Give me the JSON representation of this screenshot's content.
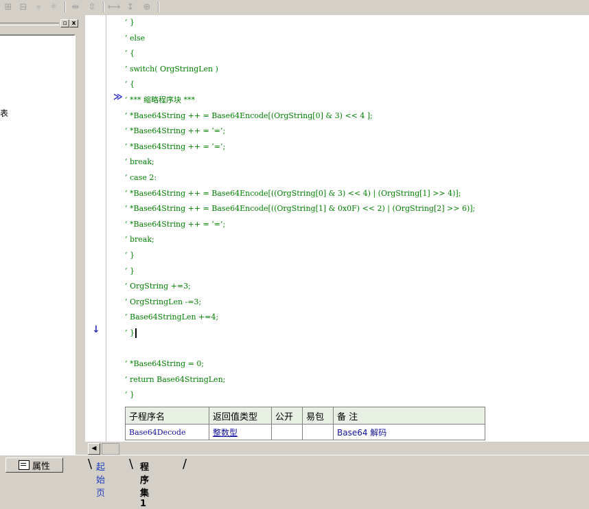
{
  "toolbar": {
    "icons": [
      "align-left-icon",
      "align-center-icon",
      "align-top-icon",
      "align-middle-icon",
      "space-horizontal-icon",
      "space-vertical-icon",
      "same-width-icon",
      "same-height-icon",
      "same-size-icon"
    ]
  },
  "left_pane": {
    "minimize_glyph": "▫",
    "close_glyph": "x",
    "stray_char": "表"
  },
  "editor": {
    "lines": [
      "’ }",
      "’ else",
      "’ {",
      "’ switch( OrgStringLen )",
      "’ {",
      "’ *** 缩略程序块 ***",
      "’ *Base64String ++ = Base64Encode[(OrgString[0] & 3) << 4 ];",
      "’ *Base64String ++ = ’=’;",
      "’ *Base64String ++ = ’=’;",
      "’ break;",
      "’ case 2:",
      "’ *Base64String ++ = Base64Encode[((OrgString[0] & 3) << 4) | (OrgString[1] >> 4)];",
      "’ *Base64String ++ = Base64Encode[((OrgString[1] & 0x0F) << 2) | (OrgString[2] >> 6)];",
      "’ *Base64String ++ = ’=’;",
      "’ break;",
      "’ }",
      "’ }",
      "’ OrgString +=3;",
      "’ OrgStringLen -=3;",
      "’ Base64StringLen +=4;",
      "’ }",
      "",
      "’ *Base64String = 0;",
      "’ return Base64StringLen;",
      "’ }"
    ],
    "collapsed_marker": "≫",
    "exec_marker": "↓"
  },
  "sub_table": {
    "headers": [
      "子程序名",
      "返回值类型",
      "公开",
      "易包",
      "备 注"
    ],
    "row": [
      "Base64Decode",
      "整数型",
      "",
      "",
      "Base64 解码"
    ]
  },
  "scroll": {
    "left_glyph": "◀"
  },
  "bottom": {
    "properties_label": "属性",
    "tabs": [
      "起始页",
      "程序集1"
    ]
  },
  "colors": {
    "code_green": "#008000",
    "marker_blue": "#3030c0",
    "table_header_bg": "#e8f0e4"
  }
}
